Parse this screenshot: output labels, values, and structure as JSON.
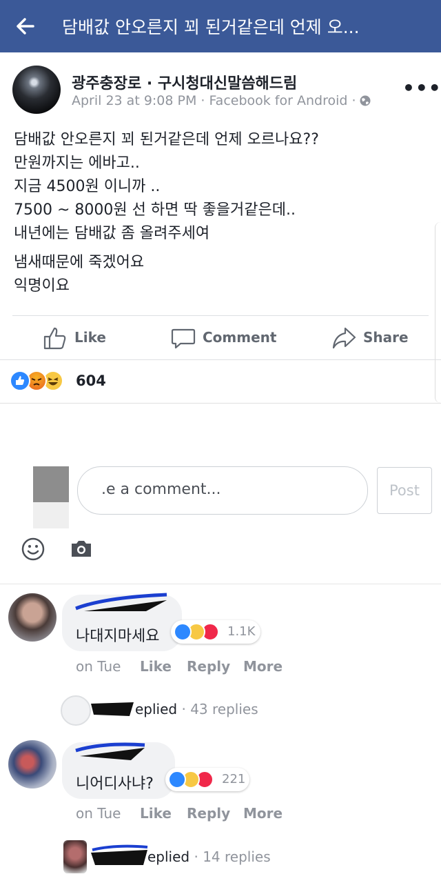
{
  "topbar": {
    "title": "담배값 안오른지 꾀 된거같은데 언제 오..."
  },
  "post": {
    "author": "광주충장로 · 구시청대신말씀해드림",
    "meta": "April 23 at 9:08 PM · Facebook for Android ·",
    "lines": [
      "담배값 안오른지 꾀 된거같은데 언제 오르나요??",
      "만원까지는 에바고..",
      "지금 4500원 이니까 ..",
      "7500 ~ 8000원 선 하면 딱 좋을거같은데..",
      "내년에는 담배값 좀 올려주세여"
    ],
    "lines2": [
      "냄새때문에 죽겠어요",
      "익명이요"
    ],
    "actions": {
      "like": "Like",
      "comment": "Comment",
      "share": "Share"
    },
    "reaction_count": "604"
  },
  "composer": {
    "placeholder": ".e a comment...",
    "post_label": "Post"
  },
  "comments": [
    {
      "text": "나대지마세요",
      "reaction_count": "1.1K",
      "time": "on Tue",
      "like": "Like",
      "reply": "Reply",
      "more": "More",
      "replied_label": "eplied",
      "replies": " · 43 replies"
    },
    {
      "text": "니어디사냐?",
      "reaction_count": "221",
      "time": "on Tue",
      "like": "Like",
      "reply": "Reply",
      "more": "More",
      "replied_label": "eplied",
      "replies": " · 14 replies"
    }
  ],
  "colors": {
    "brand": "#3b5998",
    "like_blue": "#2d88ff",
    "angry": "#f26d2b",
    "haha": "#f7c844",
    "love": "#f0284a"
  }
}
